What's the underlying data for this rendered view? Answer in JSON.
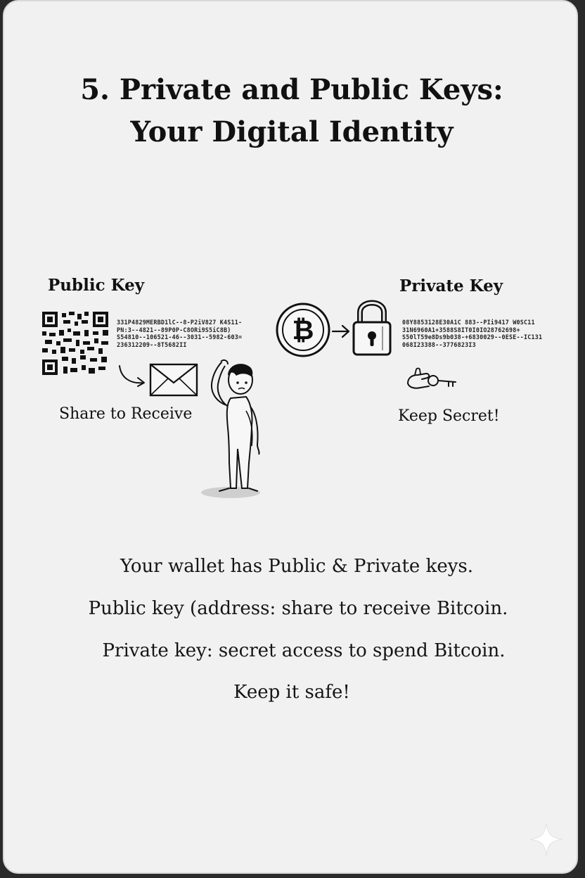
{
  "title": {
    "line1": "5. Private and Public Keys:",
    "line2": "Your Digital Identity"
  },
  "public_key": {
    "label": "Public Key",
    "text_lines": [
      "331P4829MERBD1lC--8-P2iV827 K4S11-",
      "PN:3--4821--89P0P-C8ORi9S5iC8B)",
      "S54810--106521-46--3031--5982-603=",
      "236312209--8T5682II"
    ],
    "caption": "Share to Receive"
  },
  "private_key": {
    "label": "Private Key",
    "text_lines": [
      "08Y8853128E30A1C 883--PIi9417 W0SC11",
      "31N6960A1+3588S8IT0I0IO28762698+",
      "S50lT59e8Ds9b038-+6830029--0ESE--IC131",
      "068I23388--3776823I3"
    ],
    "caption": "Keep Secret!"
  },
  "body": {
    "lines": [
      "Your wallet has Public & Private keys.",
      "Public key (address: share to receive Bitcoin.",
      "Private key: secret access to spend Bitcoin.",
      "Keep it safe!"
    ]
  },
  "icons": [
    "qr-code-icon",
    "arrow-icon",
    "envelope-icon",
    "bitcoin-coin-icon",
    "padlock-icon",
    "hand-key-icon",
    "confused-person-icon",
    "sparkle-icon"
  ],
  "colors": {
    "card": "#f1f1f1",
    "ink": "#111111",
    "frame": "#2a2a2a"
  }
}
